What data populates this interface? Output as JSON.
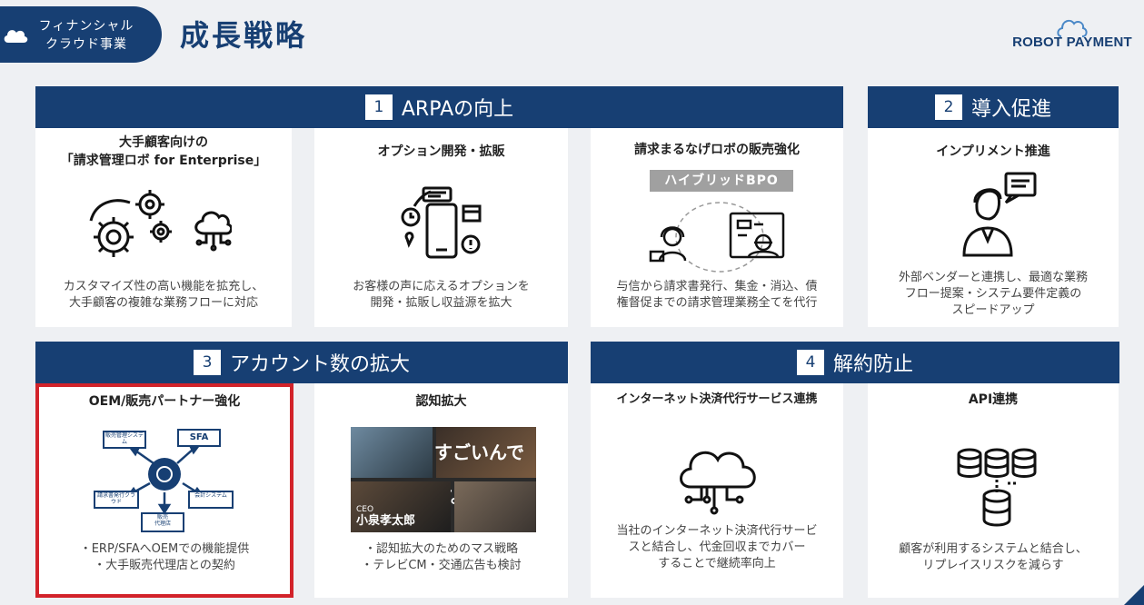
{
  "header": {
    "category_line1": "フィナンシャル",
    "category_line2": "クラウド事業",
    "title": "成長戦略",
    "logo_text": "ROBOT PAYMENT"
  },
  "sections": {
    "s1": {
      "num": "1",
      "label": "ARPAの向上"
    },
    "s2": {
      "num": "2",
      "label": "導入促進"
    },
    "s3": {
      "num": "3",
      "label": "アカウント数の拡大"
    },
    "s4": {
      "num": "4",
      "label": "解約防止"
    }
  },
  "cards": {
    "enterprise": {
      "title_l1": "大手顧客向けの",
      "title_l2": "「請求管理ロボ for Enterprise」",
      "desc_l1": "カスタマイズ性の高い機能を拡充し、",
      "desc_l2": "大手顧客の複雑な業務フローに対応"
    },
    "option": {
      "title": "オプション開発・拡販",
      "desc_l1": "お客様の声に応えるオプションを",
      "desc_l2": "開発・拡販し収益源を拡大"
    },
    "bpo": {
      "title": "請求まるなげロボの販売強化",
      "badge": "ハイブリッドBPO",
      "desc_l1": "与信から請求書発行、集金・消込、債",
      "desc_l2": "権督促までの請求管理業務全てを代行"
    },
    "implement": {
      "title": "インプリメント推進",
      "desc_l1": "外部ベンダーと連携し、最適な業務",
      "desc_l2": "フロー提案・システム要件定義の",
      "desc_l3": "スピードアップ"
    },
    "oem": {
      "title": "OEM/販売パートナー強化",
      "node_tl": "販売管理システム",
      "node_sfa": "SFA",
      "node_bl": "請求書発行クラウド",
      "node_br": "会計システム",
      "node_bottom_l1": "販売",
      "node_bottom_l2": "代理店",
      "bullet1": "・ERP/SFAへOEMでの機能提供",
      "bullet2": "・大手販売代理店との契約"
    },
    "awareness": {
      "title": "認知拡大",
      "photo_caption": "すごいんです。",
      "ceo_role": "CEO",
      "ceo_name": "小泉孝太郎",
      "bullet1": "・認知拡大のためのマス戦略",
      "bullet2": "・テレビCM・交通広告も検討"
    },
    "payment": {
      "title": "インターネット決済代行サービス連携",
      "desc_l1": "当社のインターネット決済代行サービ",
      "desc_l2": "スと結合し、代金回収までカバー",
      "desc_l3": "することで継続率向上"
    },
    "api": {
      "title": "API連携",
      "desc_l1": "顧客が利用するシステムと結合し、",
      "desc_l2": "リプレイスリスクを減らす"
    }
  },
  "colors": {
    "navy": "#173f73",
    "highlight": "#d2232a",
    "background": "#eef0f3"
  }
}
